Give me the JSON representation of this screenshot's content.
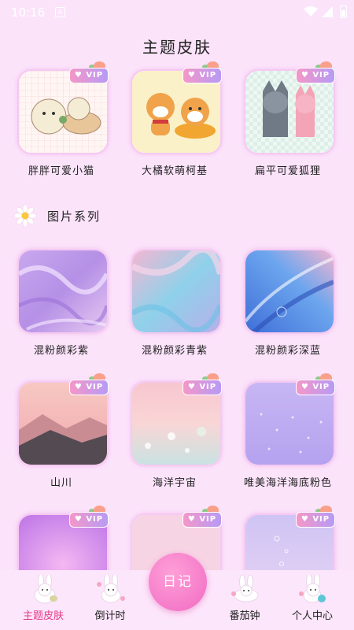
{
  "status": {
    "time": "10:16",
    "notif_glyph": "A"
  },
  "page_title": "主题皮肤",
  "section": {
    "label": "图片系列",
    "icon": "daisy-icon"
  },
  "vip_badge_label": "VIP",
  "themes": [
    {
      "label": "胖胖可爱小猫",
      "art": "cats",
      "vip": true
    },
    {
      "label": "大橘软萌柯基",
      "art": "corgi",
      "vip": true
    },
    {
      "label": "扁平可爱狐狸",
      "art": "foxes",
      "vip": true
    }
  ],
  "images": [
    {
      "label": "混粉颜彩紫",
      "art": "marble-purple",
      "vip": false
    },
    {
      "label": "混粉颜彩青紫",
      "art": "marble-cyan",
      "vip": false
    },
    {
      "label": "混粉颜彩深蓝",
      "art": "marble-blue",
      "vip": false
    },
    {
      "label": "山川",
      "art": "mountains",
      "vip": true
    },
    {
      "label": "海洋宇宙",
      "art": "ocean-pink",
      "vip": true
    },
    {
      "label": "唯美海洋海底粉色",
      "art": "ocean-purple",
      "vip": true
    },
    {
      "label": "",
      "art": "violet-glow",
      "vip": true
    },
    {
      "label": "",
      "art": "pink-plain",
      "vip": true
    },
    {
      "label": "",
      "art": "lavender-bubbles",
      "vip": true
    }
  ],
  "tabs": [
    {
      "label": "主题皮肤",
      "active": true,
      "icon": "bunny-icon"
    },
    {
      "label": "倒计时",
      "active": false,
      "icon": "bunny-icon"
    },
    {
      "label": "番茄钟",
      "active": false,
      "icon": "bunny-icon"
    },
    {
      "label": "个人中心",
      "active": false,
      "icon": "bunny-icon"
    }
  ],
  "center_button_label": "日记",
  "colors": {
    "background": "#fbe3fa",
    "active_tab": "#e23b86",
    "center_button": "#f06bc2",
    "vip_start": "#f497c8",
    "vip_end": "#b79af5"
  }
}
